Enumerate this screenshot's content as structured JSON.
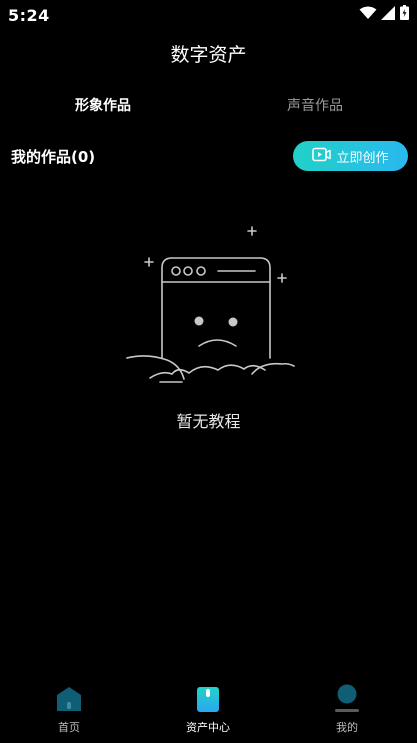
{
  "status_bar": {
    "time": "5:24"
  },
  "header": {
    "title": "数字资产"
  },
  "tabs": [
    {
      "label": "形象作品",
      "active": true
    },
    {
      "label": "声音作品",
      "active": false
    }
  ],
  "works": {
    "title": "我的作品(0)",
    "create_button_label": "立即创作"
  },
  "empty_state": {
    "message": "暂无教程"
  },
  "bottom_nav": [
    {
      "label": "首页",
      "icon": "home-icon"
    },
    {
      "label": "资产中心",
      "icon": "asset-center-icon",
      "active": true
    },
    {
      "label": "我的",
      "icon": "profile-icon"
    }
  ],
  "colors": {
    "background": "#000000",
    "accent_gradient_start": "#21d1c6",
    "accent_gradient_end": "#2ab8f0",
    "inactive_text": "#9a9a9a"
  }
}
